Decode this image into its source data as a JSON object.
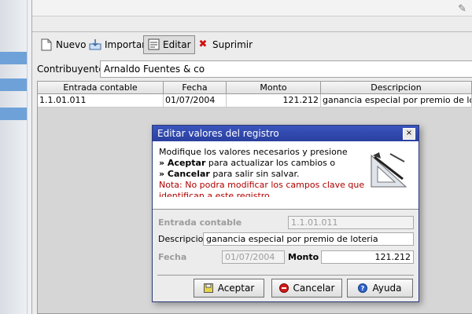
{
  "toolbar": {
    "nuevo": "Nuevo",
    "importar": "Importar",
    "editar": "Editar",
    "suprimir": "Suprimir"
  },
  "contribuyentes": {
    "label": "Contribuyentes",
    "value": "Arnaldo Fuentes & co"
  },
  "grid": {
    "columns": [
      "Entrada contable",
      "Fecha",
      "Monto",
      "Descripcion"
    ],
    "rows": [
      [
        "1.1.01.011",
        "01/07/2004",
        "121.212",
        "ganancia especial por premio de loteria"
      ]
    ]
  },
  "dialog": {
    "title": "Editar valores del registro",
    "close": "×",
    "message_line1": "Modifique los valores necesarios y presione",
    "aceptar_prefix": "» Aceptar",
    "aceptar_suffix": " para actualizar los cambios o",
    "cancelar_prefix": "» Cancelar",
    "cancelar_suffix": " para salir sin salvar.",
    "note": "Nota: No podra modificar los campos clave que",
    "note_cut": "identifican a este registro",
    "fields": {
      "entrada_label": "Entrada contable",
      "entrada_value": "1.1.01.011",
      "descripcion_label": "Descripcion",
      "descripcion_value": "ganancia especial por premio de loteria",
      "fecha_label": "Fecha",
      "fecha_value": "01/07/2004",
      "monto_label": "Monto",
      "monto_value": "121.212"
    },
    "buttons": {
      "aceptar": "Aceptar",
      "cancelar": "Cancelar",
      "ayuda": "Ayuda"
    }
  },
  "colors": {
    "title_blue": "#2a3fa0",
    "note_red": "#b00000",
    "sidebar_blue": "#6ea1d8"
  }
}
